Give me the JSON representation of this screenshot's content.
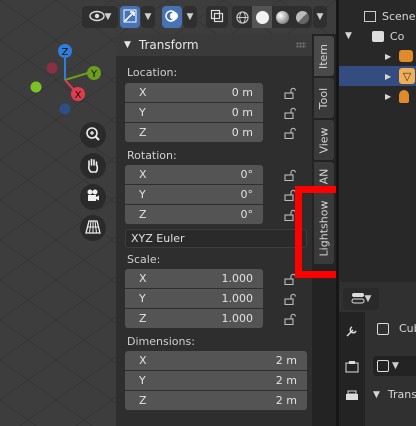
{
  "panel": {
    "title": "Transform"
  },
  "location": {
    "label": "Location:",
    "fields": [
      {
        "axis": "X",
        "value": "0 m"
      },
      {
        "axis": "Y",
        "value": "0 m"
      },
      {
        "axis": "Z",
        "value": "0 m"
      }
    ]
  },
  "rotation": {
    "label": "Rotation:",
    "fields": [
      {
        "axis": "X",
        "value": "0°"
      },
      {
        "axis": "Y",
        "value": "0°"
      },
      {
        "axis": "Z",
        "value": "0°"
      }
    ],
    "mode": "XYZ Euler"
  },
  "scale": {
    "label": "Scale:",
    "fields": [
      {
        "axis": "X",
        "value": "1.000"
      },
      {
        "axis": "Y",
        "value": "1.000"
      },
      {
        "axis": "Z",
        "value": "1.000"
      }
    ]
  },
  "dimensions": {
    "label": "Dimensions:",
    "fields": [
      {
        "axis": "X",
        "value": "2 m"
      },
      {
        "axis": "Y",
        "value": "2 m"
      },
      {
        "axis": "Z",
        "value": "2 m"
      }
    ]
  },
  "tabs": [
    {
      "label": "Item"
    },
    {
      "label": "Tool"
    },
    {
      "label": "View"
    },
    {
      "label": "AN"
    },
    {
      "label": "Lightshow"
    }
  ],
  "gizmo": {
    "z": "Z",
    "y": "Y",
    "x": "X"
  },
  "outliner": {
    "scene": "Scene",
    "collection": "Co"
  },
  "properties": {
    "object": "Cub",
    "section": "Trans"
  },
  "colors": {
    "accent": "#4772b3",
    "highlight": "#ff0000",
    "axis_x": "#e23b4e",
    "axis_y": "#6b9e1f",
    "axis_z": "#2e7fdc"
  },
  "icons": [
    "eye-icon",
    "select-tool-icon",
    "overlay-icon",
    "xray-icon",
    "zoom-icon",
    "hand-icon",
    "camera-icon",
    "grid-icon",
    "lock-icon"
  ]
}
